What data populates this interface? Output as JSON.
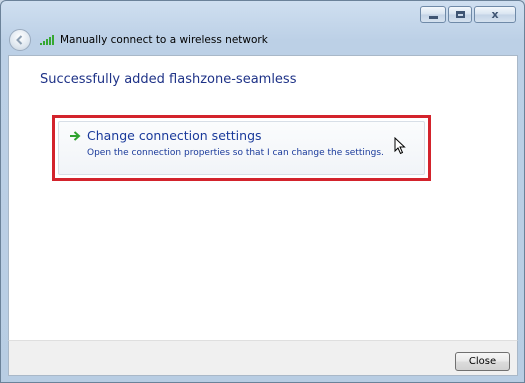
{
  "window": {
    "caption_buttons": {
      "minimize_icon": "minimize-icon",
      "maximize_icon": "maximize-icon",
      "close_label": "x"
    },
    "nav_title": "Manually connect to a wireless network"
  },
  "content": {
    "heading": "Successfully added flashzone-seamless",
    "command_link": {
      "title": "Change connection settings",
      "description": "Open the connection properties so that I can change the settings.",
      "icon": "green-arrow-icon"
    }
  },
  "footer": {
    "close_label": "Close"
  },
  "colors": {
    "heading": "#1e3287",
    "link_text": "#1a3a9b",
    "highlight_border": "#d3232c",
    "signal_green": "#36a832"
  }
}
